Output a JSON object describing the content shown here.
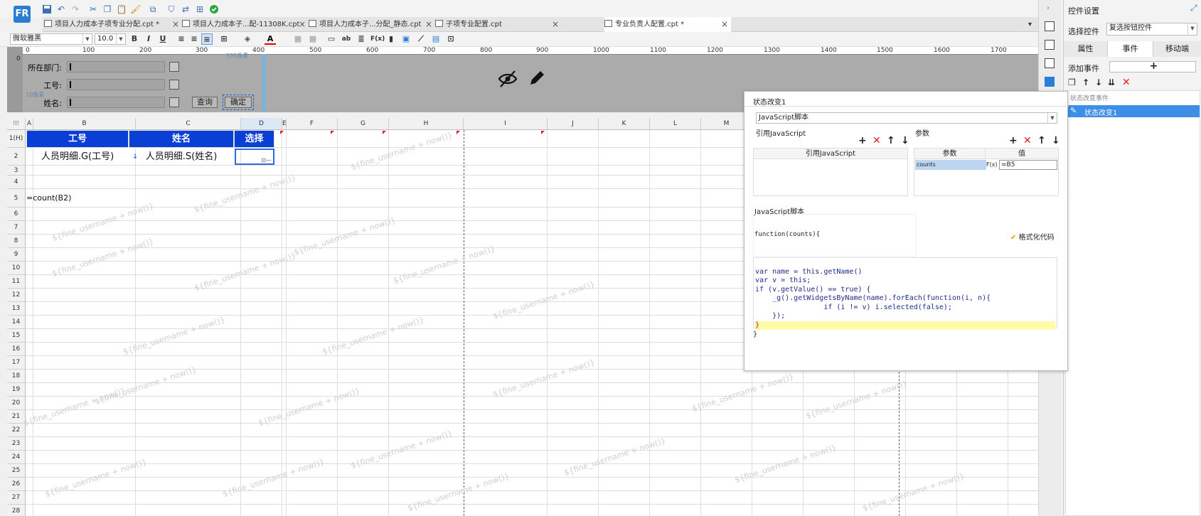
{
  "toolbar": {
    "logo": "FR",
    "icons": [
      "save-icon",
      "undo-icon",
      "redo-icon",
      "cut-icon",
      "copy-icon",
      "paste-icon",
      "format-brush-icon",
      "preview-icon",
      "filter-icon",
      "link-icon",
      "export-icon",
      "check-icon"
    ]
  },
  "tabs": [
    {
      "label": "项目人力成本子项专业分配.cpt *"
    },
    {
      "label": "项目人力成本子...配-11308K.cpt"
    },
    {
      "label": "项目人力成本子...分配_静态.cpt"
    },
    {
      "label": "子项专业配置.cpt"
    },
    {
      "label": "专业负责人配置.cpt *"
    }
  ],
  "format": {
    "font": "微软雅黑",
    "size": "10.0",
    "bold": "B",
    "italic": "I",
    "underline": "U"
  },
  "ruler": {
    "ticks": [
      "0",
      "100",
      "200",
      "300",
      "400",
      "500",
      "600",
      "700",
      "800",
      "900",
      "1000",
      "1100",
      "1200",
      "1300",
      "1400",
      "1500",
      "1600",
      "1700"
    ]
  },
  "param_panel": {
    "fields": [
      {
        "label": "所在部门:"
      },
      {
        "label": "工号:"
      },
      {
        "label": "姓名:"
      }
    ],
    "query_button": "查询",
    "confirm_button": "确定",
    "side_marker": "0",
    "hint_a": "335像素",
    "hint_b": "10像素"
  },
  "grid": {
    "columns": [
      "A",
      "B",
      "C",
      "D",
      "E",
      "F",
      "G",
      "H",
      "I",
      "J",
      "K",
      "L",
      "M"
    ],
    "rows": [
      "1(H)",
      "2",
      "3",
      "4",
      "5",
      "6",
      "7",
      "8",
      "9",
      "10",
      "11",
      "12",
      "13",
      "14",
      "15",
      "16",
      "17",
      "18",
      "19",
      "20",
      "21",
      "22",
      "23",
      "24",
      "25",
      "26",
      "27",
      "28"
    ],
    "header_cells": [
      "工号",
      "姓名",
      "选择"
    ],
    "data_cells": [
      "人员明细.G(工号)",
      "人员明细.S(姓名)"
    ],
    "formula_cell": "=count(B2)",
    "watermark": "${fine_username + now()}"
  },
  "right_panel": {
    "title": "控件设置",
    "select_label": "选择控件",
    "select_value": "复选按钮控件",
    "tabs": [
      "属性",
      "事件",
      "移动端"
    ],
    "add_event_label": "添加事件",
    "add_event_symbol": "+",
    "section_label": "状态改变事件",
    "event_item": "状态改变1"
  },
  "event_dialog": {
    "title": "状态改变1",
    "type_select": "JavaScript脚本",
    "ref_js_label": "引用JavaScript",
    "params_label": "参数",
    "ref_js_col": "引用JavaScript",
    "param_col": "参数",
    "value_col": "值",
    "param_name": "counts",
    "param_value": "=B5",
    "fx_label": "F(x)",
    "js_label": "JavaScript脚本",
    "func_sig": "function(counts){",
    "format_code": "格式化代码",
    "code_lines": [
      "var name = this.getName()",
      "var v = this;",
      "if (v.getValue() == true) {",
      "    _g().getWidgetsByName(name).forEach(function(i, n){",
      "                if (i != v) i.selected(false);",
      "    });",
      "}"
    ],
    "closing": "}"
  },
  "colors": {
    "accent": "#0a3fd6",
    "selected": "#3d8ee6",
    "highlight": "#fffaa8",
    "red": "#e02020"
  }
}
